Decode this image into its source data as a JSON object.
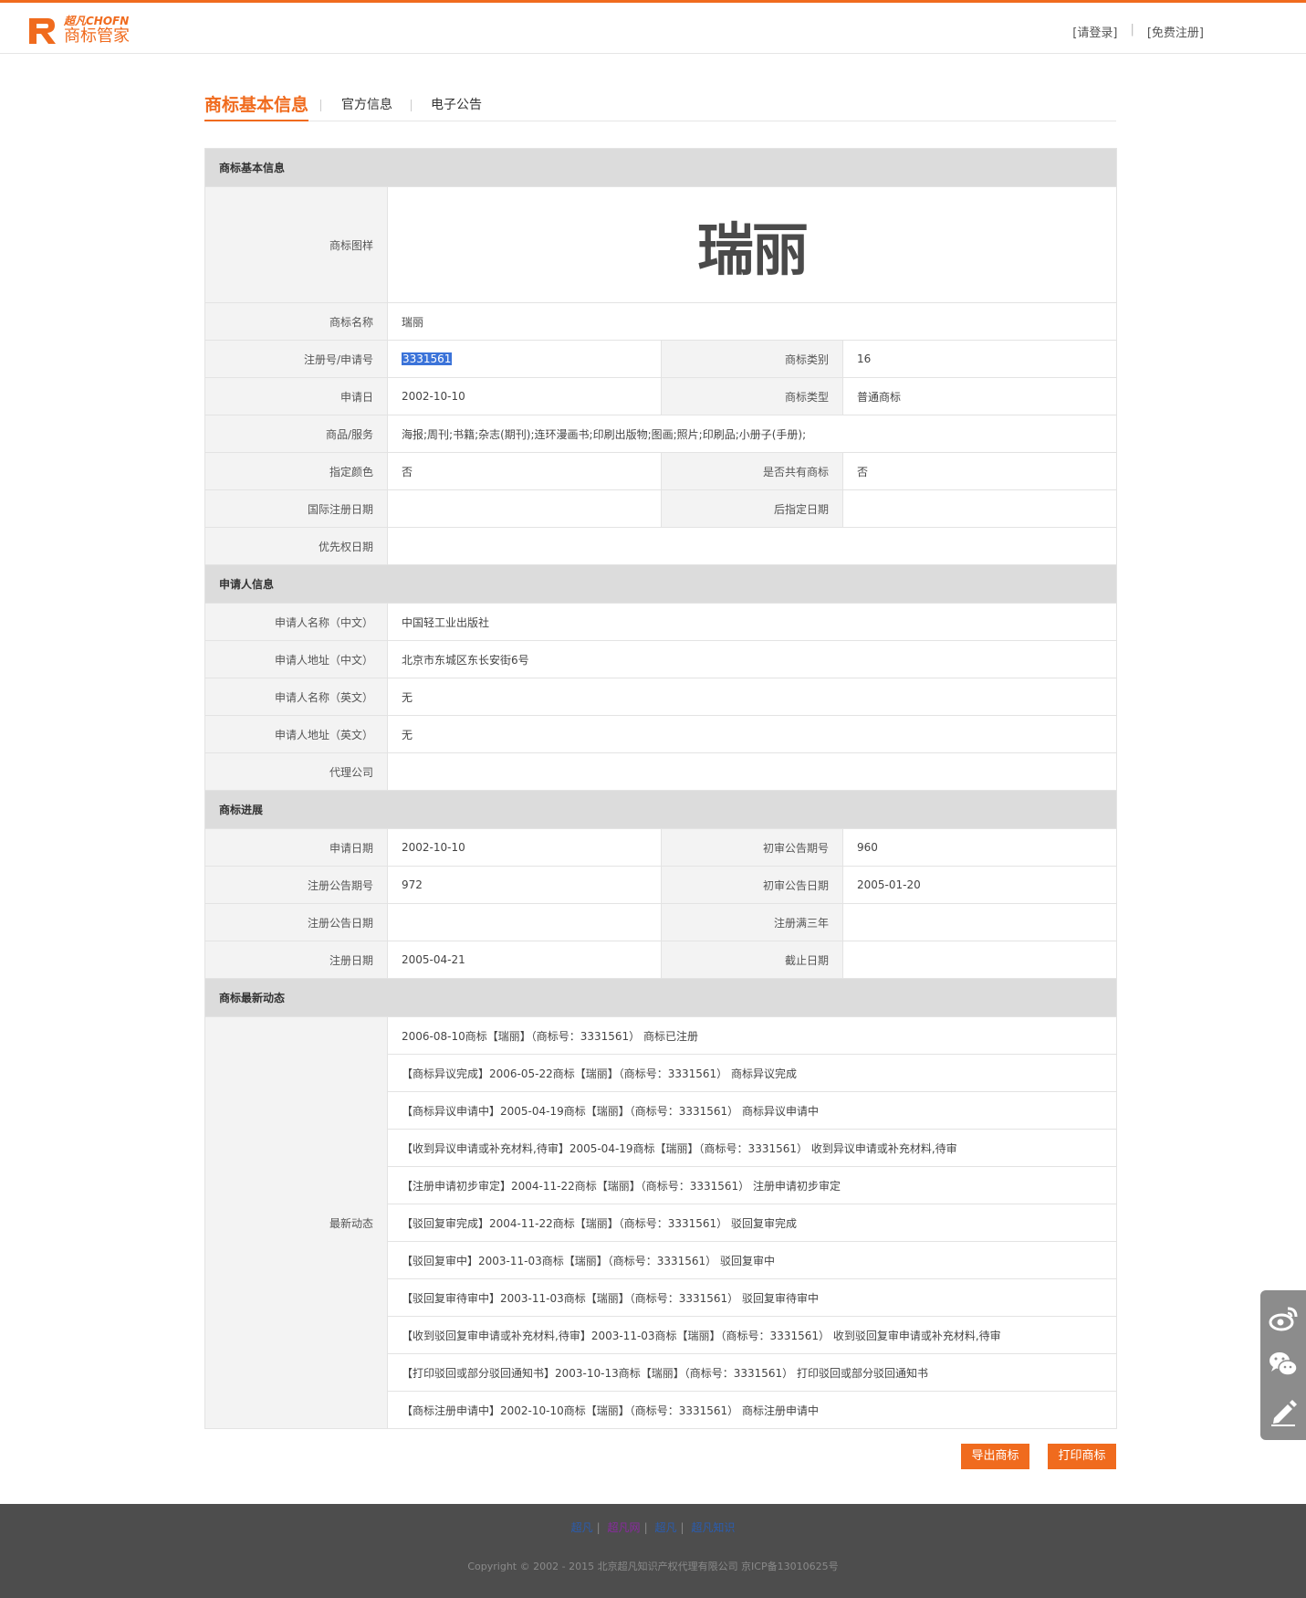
{
  "header": {
    "logo_small": "超凡CHOFN",
    "logo_main": "商标管家",
    "login": "[请登录]",
    "register": "[免费注册]",
    "brand_color": "#f06b1e"
  },
  "tabs": [
    "商标基本信息",
    "官方信息",
    "电子公告"
  ],
  "basic": {
    "section": "商标基本信息",
    "image_label": "商标图样",
    "mark_text": "瑞丽",
    "name_label": "商标名称",
    "name": "瑞丽",
    "regno_label": "注册号/申请号",
    "regno": "3331561",
    "class_label": "商标类别",
    "class": "16",
    "appdate_label": "申请日",
    "appdate": "2002-10-10",
    "type_label": "商标类型",
    "type": "普通商标",
    "goods_label": "商品/服务",
    "goods": "海报;周刊;书籍;杂志(期刊);连环漫画书;印刷出版物;图画;照片;印刷品;小册子(手册);",
    "color_label": "指定颜色",
    "color": "否",
    "shared_label": "是否共有商标",
    "shared": "否",
    "intl_label": "国际注册日期",
    "intl": "",
    "later_label": "后指定日期",
    "later": "",
    "priority_label": "优先权日期",
    "priority": ""
  },
  "applicant": {
    "section": "申请人信息",
    "name_cn_label": "申请人名称（中文）",
    "name_cn": "中国轻工业出版社",
    "addr_cn_label": "申请人地址（中文）",
    "addr_cn": "北京市东城区东长安街6号",
    "name_en_label": "申请人名称（英文）",
    "name_en": "无",
    "addr_en_label": "申请人地址（英文）",
    "addr_en": "无",
    "agent_label": "代理公司",
    "agent": ""
  },
  "progress": {
    "section": "商标进展",
    "appdate_label": "申请日期",
    "appdate": "2002-10-10",
    "prelim_no_label": "初审公告期号",
    "prelim_no": "960",
    "reg_no_label": "注册公告期号",
    "reg_no": "972",
    "prelim_date_label": "初审公告日期",
    "prelim_date": "2005-01-20",
    "reg_pub_label": "注册公告日期",
    "reg_pub": "",
    "three_label": "注册满三年",
    "three": "",
    "reg_date_label": "注册日期",
    "reg_date": "2005-04-21",
    "end_label": "截止日期",
    "end": ""
  },
  "news": {
    "section": "商标最新动态",
    "label": "最新动态",
    "items": [
      "2006-08-10商标【瑞丽】（商标号：3331561） 商标已注册",
      "【商标异议完成】2006-05-22商标【瑞丽】（商标号：3331561） 商标异议完成",
      "【商标异议申请中】2005-04-19商标【瑞丽】（商标号：3331561） 商标异议申请中",
      "【收到异议申请或补充材料,待审】2005-04-19商标【瑞丽】（商标号：3331561） 收到异议申请或补充材料,待审",
      "【注册申请初步审定】2004-11-22商标【瑞丽】（商标号：3331561） 注册申请初步审定",
      "【驳回复审完成】2004-11-22商标【瑞丽】（商标号：3331561） 驳回复审完成",
      "【驳回复审中】2003-11-03商标【瑞丽】（商标号：3331561） 驳回复审中",
      "【驳回复审待审中】2003-11-03商标【瑞丽】（商标号：3331561） 驳回复审待审中",
      "【收到驳回复审申请或补充材料,待审】2003-11-03商标【瑞丽】（商标号：3331561） 收到驳回复审申请或补充材料,待审",
      "【打印驳回或部分驳回通知书】2003-10-13商标【瑞丽】（商标号：3331561） 打印驳回或部分驳回通知书",
      "【商标注册申请中】2002-10-10商标【瑞丽】（商标号：3331561） 商标注册申请中"
    ]
  },
  "actions": {
    "export": "导出商标",
    "print": "打印商标"
  },
  "footer": {
    "links": [
      {
        "text": "超凡",
        "color": "#2a5db0"
      },
      {
        "text": "超凡网",
        "color": "#8a2aa0"
      },
      {
        "text": "超凡",
        "color": "#2a5db0"
      },
      {
        "text": "超凡知识",
        "color": "#2a5db0"
      }
    ],
    "copyright": "Copyright © 2002 - 2015 北京超凡知识产权代理有限公司 京ICP备13010625号"
  },
  "side_icons": [
    "weibo-icon",
    "wechat-icon",
    "edit-icon"
  ]
}
